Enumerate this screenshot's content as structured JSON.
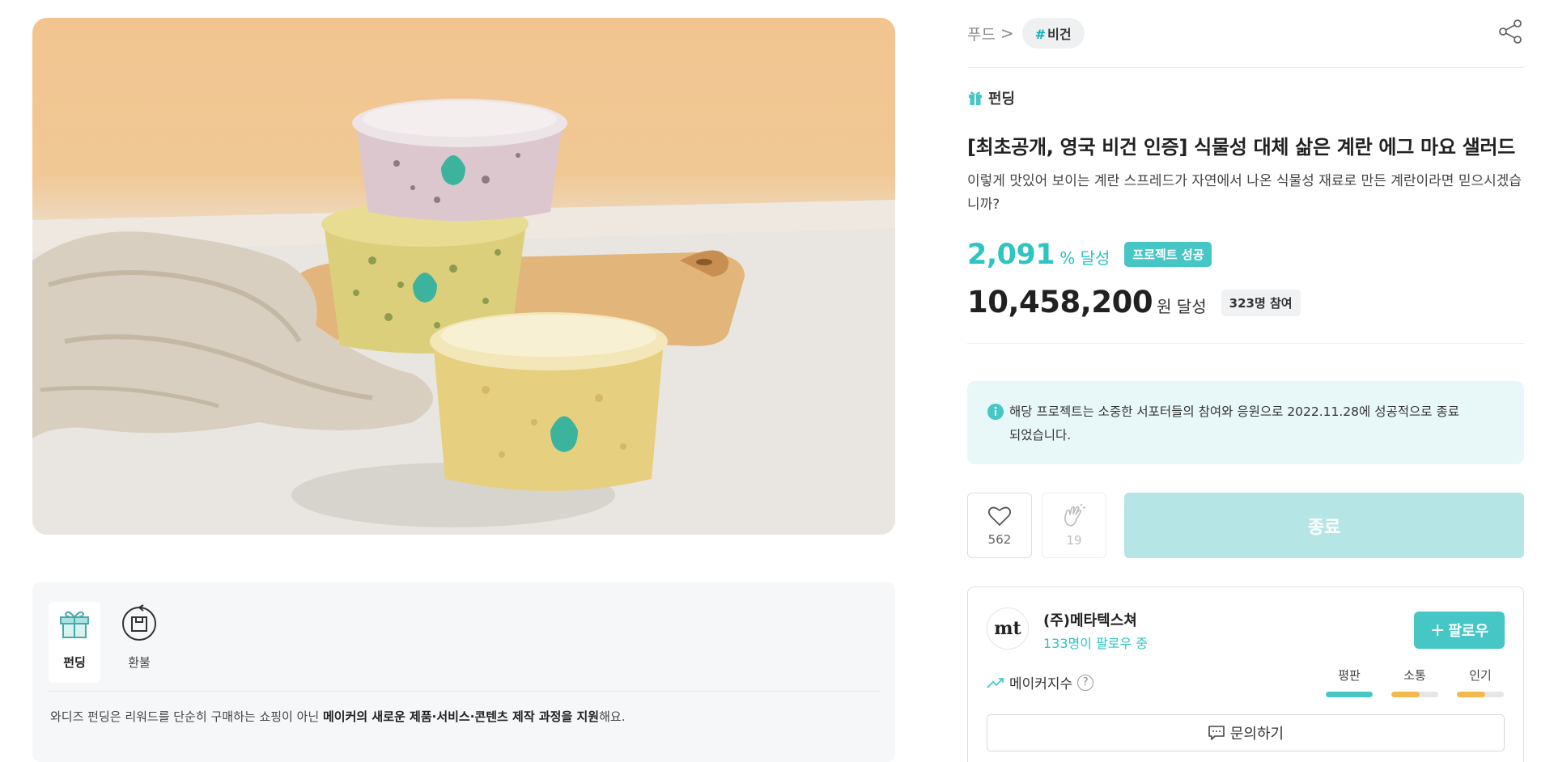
{
  "hero": {
    "image_alt": ""
  },
  "info_panel": {
    "tabs": [
      {
        "label": "펀딩",
        "icon": "gift-icon"
      },
      {
        "label": "환불",
        "icon": "refund-icon"
      }
    ],
    "text_prefix": "와디즈 펀딩은 리워드를 단순히 구매하는 쇼핑이 아닌 ",
    "text_bold": "메이커의 새로운 제품·서비스·콘텐츠 제작 과정을 지원",
    "text_suffix": "해요."
  },
  "breadcrumb": {
    "category": "푸드",
    "separator": ">",
    "tag_hash": "#",
    "tag": "비건"
  },
  "product": {
    "kind": "펀딩",
    "title": "[최초공개, 영국 비건 인증] 식물성 대체 삶은 계란 에그 마요 샐러드",
    "subtitle": "이렇게 맛있어 보이는 계란 스프레드가 자연에서 나온 식물성 재료로 만든 계란이라면 믿으시겠습니까?"
  },
  "stats": {
    "percent": "2,091",
    "percent_unit": "% 달성",
    "success_badge": "프로젝트 성공",
    "amount": "10,458,200",
    "amount_unit": "원 달성",
    "participants": "323명 참여"
  },
  "notice": {
    "text": "해당 프로젝트는 소중한 서포터들의 참여와 응원으로 2022.11.28에 성공적으로 종료되었습니다."
  },
  "actions": {
    "like_count": "562",
    "clap_count": "19",
    "end_label": "종료"
  },
  "maker": {
    "logo_text": "mt",
    "name": "(주)메타텍스쳐",
    "followers": "133명이 팔로우 중",
    "follow_plus": "+",
    "follow_label": "팔로우",
    "index_label": "메이커지수",
    "help_mark": "?",
    "metrics": [
      {
        "label": "평판",
        "level": 1.0,
        "color": "#47c6c6"
      },
      {
        "label": "소통",
        "level": 0.6,
        "color": "#f5b84a"
      },
      {
        "label": "인기",
        "level": 0.6,
        "color": "#f5b84a"
      }
    ],
    "inquiry_label": "문의하기"
  },
  "colors": {
    "accent": "#2ec4c1",
    "accent_button": "#47c6c6",
    "ended_button": "#b5e6e5",
    "notice_bg": "#e8f7f8"
  }
}
